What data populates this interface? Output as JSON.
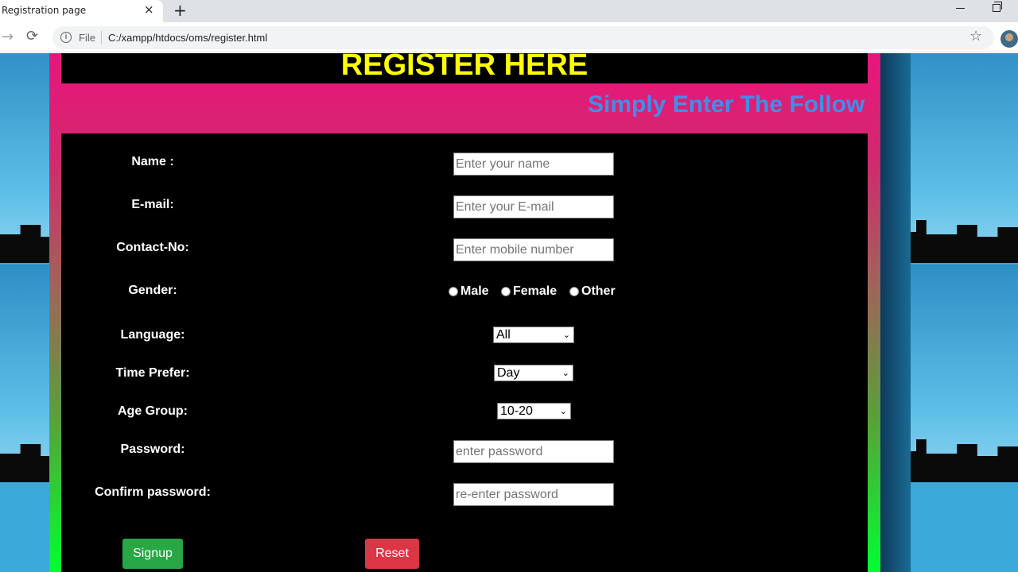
{
  "browser": {
    "tab_title": "Registration page",
    "tab_close": "×",
    "new_tab": "+",
    "forward": "→",
    "reload": "⟳",
    "info": "i",
    "file_label": "File",
    "url": "C:/xampp/htdocs/oms/register.html",
    "star": "☆"
  },
  "page": {
    "heading": "REGISTER HERE",
    "marquee": "Simply Enter The Follow"
  },
  "form": {
    "name_label": "Name :",
    "name_placeholder": "Enter your name",
    "email_label": "E-mail:",
    "email_placeholder": "Enter your E-mail",
    "contact_label": "Contact-No:",
    "contact_placeholder": "Enter mobile number",
    "gender_label": "Gender:",
    "gender_options": [
      "Male",
      "Female",
      "Other"
    ],
    "language_label": "Language:",
    "language_value": "All",
    "time_label": "Time Prefer:",
    "time_value": "Day",
    "age_label": "Age Group:",
    "age_value": "10-20",
    "password_label": "Password:",
    "password_placeholder": "enter password",
    "confirm_label": "Confirm password:",
    "confirm_placeholder": "re-enter password",
    "signup": "Signup",
    "reset": "Reset",
    "caret": "⌄"
  },
  "colors": {
    "heading": "#ffff00",
    "marquee": "#3f8fe8",
    "signup": "#28a745",
    "reset": "#dc3545"
  }
}
